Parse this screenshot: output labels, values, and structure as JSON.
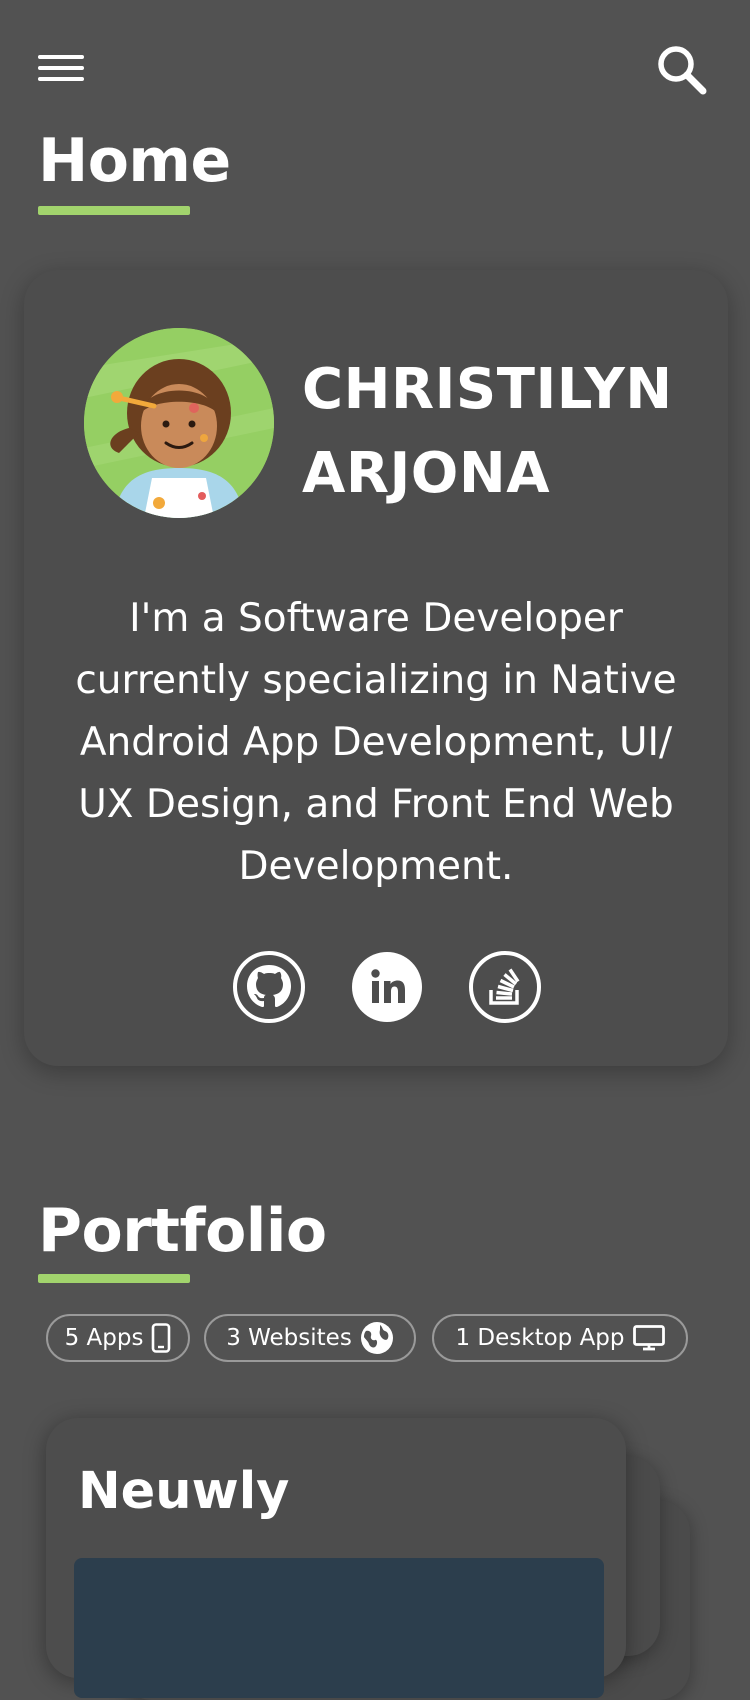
{
  "header": {
    "menu_icon": "hamburger-menu-icon",
    "search_icon": "search-icon"
  },
  "home": {
    "title": "Home",
    "accent_color": "#a2d46d"
  },
  "profile": {
    "name_line1": "CHRISTILYN",
    "name_line2": "ARJONA",
    "bio": "I'm a Software Developer currently specializing in Native Android App Development, UI/ UX Design, and Front End Web Development.",
    "social_links": [
      "github-icon",
      "linkedin-icon",
      "stackoverflow-icon"
    ]
  },
  "portfolio": {
    "title": "Portfolio",
    "chips": [
      {
        "label": "5 Apps",
        "icon": "smartphone-icon"
      },
      {
        "label": "3 Websites",
        "icon": "globe-icon"
      },
      {
        "label": "1 Desktop App",
        "icon": "desktop-monitor-icon"
      }
    ],
    "project": {
      "title": "Neuwly"
    }
  }
}
